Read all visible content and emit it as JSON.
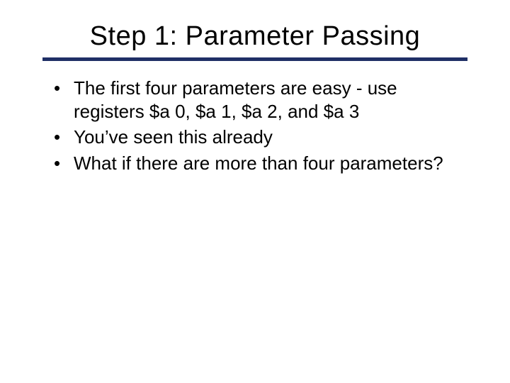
{
  "slide": {
    "title": "Step 1: Parameter Passing",
    "bullets": [
      "The first four parameters are easy - use registers $a 0, $a 1, $a 2, and $a 3",
      "You’ve seen this already",
      "What if there are more than four parameters?"
    ]
  }
}
